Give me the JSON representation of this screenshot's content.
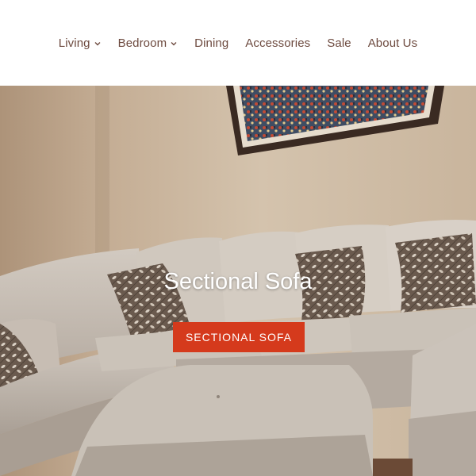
{
  "nav": {
    "items": [
      {
        "label": "Living",
        "dropdown": true
      },
      {
        "label": "Bedroom",
        "dropdown": true
      },
      {
        "label": "Dining",
        "dropdown": false
      },
      {
        "label": "Accessories",
        "dropdown": false
      },
      {
        "label": "Sale",
        "dropdown": false
      },
      {
        "label": "About Us",
        "dropdown": false
      }
    ]
  },
  "hero": {
    "title": "Sectional Sofa",
    "button_label": "SECTIONAL SOFA"
  },
  "colors": {
    "nav_text": "#6d4a3f",
    "button_bg": "#d53a1c",
    "hero_text": "#ffffff"
  }
}
